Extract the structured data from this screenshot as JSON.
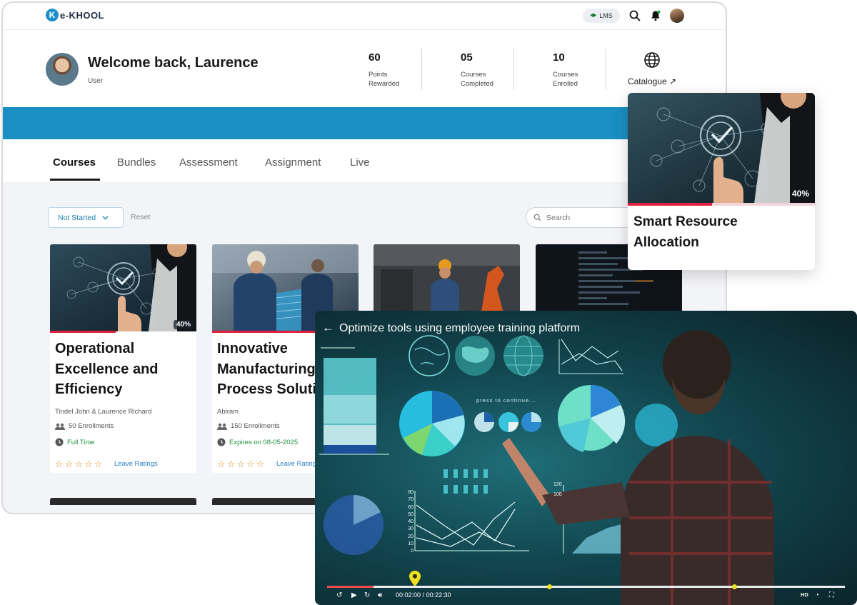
{
  "brand": {
    "logo_text": "e-KHOOL",
    "logo_mark": "K"
  },
  "topbar": {
    "lms_label": "LMS"
  },
  "profile": {
    "welcome": "Welcome back, Laurence",
    "role": "User"
  },
  "stats": [
    {
      "value": "60",
      "label": "Points Rewarded"
    },
    {
      "value": "05",
      "label": "Courses Completed"
    },
    {
      "value": "10",
      "label": "Courses Enrolled"
    }
  ],
  "catalogue": {
    "label": "Catalogue ↗"
  },
  "tabs": [
    "Courses",
    "Bundles",
    "Assessment",
    "Assignment",
    "Live"
  ],
  "filters": {
    "status": "Not Started",
    "reset": "Reset",
    "search_placeholder": "Search"
  },
  "cards": [
    {
      "title": "Operational Excellence and Efficiency",
      "percent_label": "40%",
      "progress": 0.45,
      "instructors": "Tindel John & Laurence Richard",
      "enrollments": "50 Enrollments",
      "duration": "Full Time",
      "ratings_link": "Leave Ratings"
    },
    {
      "title": "Innovative Manufacturing Process Solutions",
      "progress": 0.7,
      "instructors": "Abiram",
      "enrollments": "150 Enrollments",
      "duration": "Expires on 08-05-2025",
      "ratings_link": "Leave Ratings"
    }
  ],
  "featured_card": {
    "title": "Smart Resource Allocation",
    "percent_label": "40%",
    "progress": 0.45
  },
  "video": {
    "title": "Optimize tools using employee training platform",
    "current_time": "00:02:00",
    "duration": "00:22:30",
    "progress": 0.09,
    "overlay_text": "press to continue...",
    "quality": "HD",
    "y_ticks": [
      "80",
      "70",
      "60",
      "50",
      "40",
      "30",
      "20",
      "10",
      "0"
    ],
    "right_ticks": [
      "120",
      "100"
    ]
  }
}
